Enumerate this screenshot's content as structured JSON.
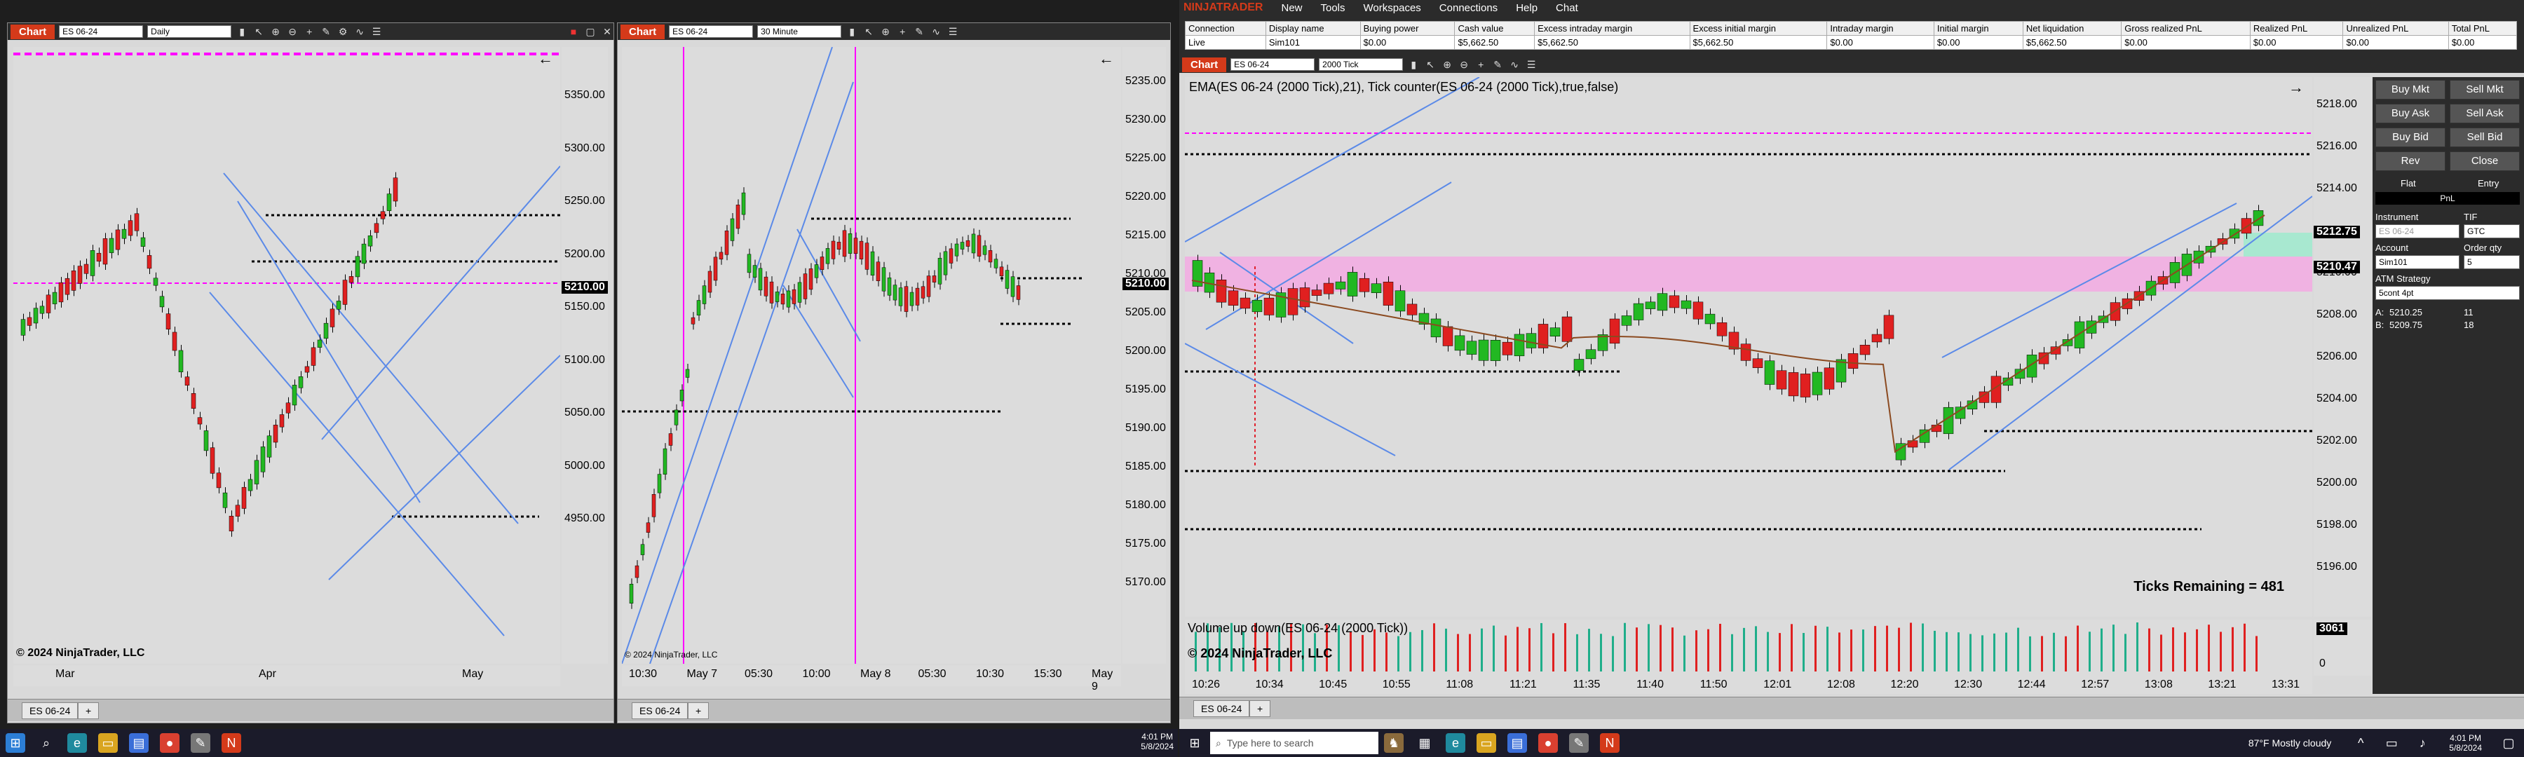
{
  "charts": [
    {
      "title": "Chart",
      "instrument": "ES 06-24",
      "period": "Daily",
      "tab": "ES 06-24",
      "copyright": "© 2024 NinjaTrader, LLC",
      "price_labels": [
        "5350.00",
        "5300.00",
        "5250.00",
        "5200.00",
        "5150.00",
        "5100.00",
        "5050.00",
        "5000.00",
        "4950.00"
      ],
      "current_price": "5210.00",
      "time_labels": [
        "Mar",
        "Apr",
        "May"
      ]
    },
    {
      "title": "Chart",
      "instrument": "ES 06-24",
      "period": "30 Minute",
      "tab": "ES 06-24",
      "copyright": "© 2024 NinjaTrader, LLC",
      "price_labels": [
        "5235.00",
        "5230.00",
        "5225.00",
        "5220.00",
        "5215.00",
        "5210.00",
        "5205.00",
        "5200.00",
        "5195.00",
        "5190.00",
        "5185.00",
        "5180.00",
        "5175.00",
        "5170.00"
      ],
      "current_price": "5210.00",
      "time_labels": [
        "10:30",
        "May 7",
        "05:30",
        "10:00",
        "May 8",
        "05:30",
        "10:30",
        "15:30",
        "May 9"
      ]
    }
  ],
  "main_window": {
    "brand": "NINJATRADER",
    "menu": [
      "New",
      "Tools",
      "Workspaces",
      "Connections",
      "Help",
      "Chat"
    ],
    "account_headers": [
      "Connection",
      "Display name",
      "Buying power",
      "Cash value",
      "Excess intraday margin",
      "Excess initial margin",
      "Intraday margin",
      "Initial margin",
      "Net liquidation",
      "Gross realized PnL",
      "Realized PnL",
      "Unrealized PnL",
      "Total PnL"
    ],
    "account_row": [
      "Live",
      "Sim101",
      "$0.00",
      "$5,662.50",
      "$5,662.50",
      "$5,662.50",
      "$0.00",
      "$0.00",
      "$5,662.50",
      "$0.00",
      "$0.00",
      "$0.00",
      "$0.00"
    ],
    "chart": {
      "title": "Chart",
      "instrument": "ES 06-24",
      "period": "2000 Tick",
      "indicator_label": "EMA(ES 06-24 (2000 Tick),21), Tick counter(ES 06-24 (2000 Tick),true,false)",
      "ticks_remaining": "Ticks Remaining = 481",
      "volume_label": "Volume up down(ES 06-24 (2000 Tick))",
      "volume_value": "3061",
      "volume_zero": "0",
      "copyright": "© 2024 NinjaTrader, LLC",
      "price_labels": [
        "5218.00",
        "5216.00",
        "5214.00",
        "5212.00",
        "5210.00",
        "5208.00",
        "5206.00",
        "5204.00",
        "5202.00",
        "5200.00",
        "5198.00",
        "5196.00"
      ],
      "price_box_1": "5212.75",
      "price_box_2": "5210.47",
      "time_labels": [
        "10:26",
        "10:34",
        "10:45",
        "10:55",
        "11:08",
        "11:21",
        "11:35",
        "11:40",
        "11:50",
        "12:01",
        "12:08",
        "12:20",
        "12:30",
        "12:44",
        "12:57",
        "13:08",
        "13:21",
        "13:31"
      ],
      "tab": "ES 06-24"
    },
    "order_panel": {
      "buttons": [
        "Buy Mkt",
        "Sell Mkt",
        "Buy Ask",
        "Sell Ask",
        "Buy Bid",
        "Sell Bid",
        "Rev",
        "Close"
      ],
      "flat": "Flat",
      "entry": "Entry",
      "pnl": "PnL",
      "instrument_label": "Instrument",
      "instrument_value": "ES 06-24",
      "tif_label": "TIF",
      "tif_value": "GTC",
      "account_label": "Account",
      "account_value": "Sim101",
      "qty_label": "Order qty",
      "qty_value": "5",
      "atm_label": "ATM Strategy",
      "atm_value": "5cont 4pt",
      "ask_label": "A:",
      "ask_price": "5210.25",
      "ask_size": "11",
      "bid_label": "B:",
      "bid_price": "5209.75",
      "bid_size": "18"
    }
  },
  "taskbar_left": {
    "time": "4:01 PM",
    "date": "5/8/2024"
  },
  "taskbar_right": {
    "search_placeholder": "Type here to search",
    "weather": "87°F  Mostly cloudy",
    "time": "4:01 PM",
    "date": "5/8/2024"
  }
}
